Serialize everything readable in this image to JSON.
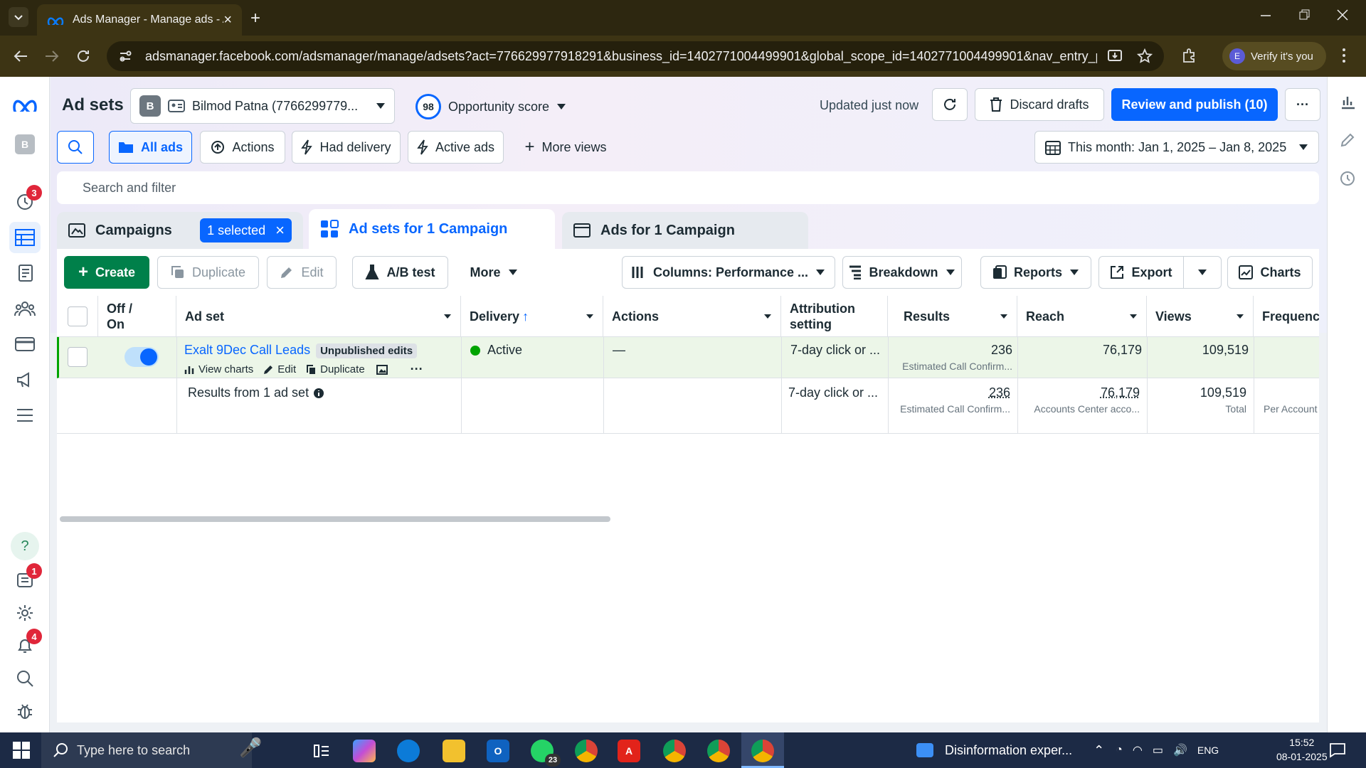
{
  "browser": {
    "tab_title": "Ads Manager - Manage ads - A",
    "url": "adsmanager.facebook.com/adsmanager/manage/adsets?act=776629977918291&business_id=1402771004499901&global_scope_id=1402771004499901&nav_entry_point=...",
    "verify_label": "Verify it's you",
    "profile_initial": "E"
  },
  "leftnav": {
    "account_initial": "B",
    "badges": {
      "clock": "3",
      "notes": "1",
      "bell": "4"
    },
    "help": "?"
  },
  "header": {
    "page_title": "Ad sets",
    "account_initial": "B",
    "account_name": "Bilmod Patna (7766299779...",
    "opportunity_value": "98",
    "opportunity_label": "Opportunity score",
    "updated": "Updated just now",
    "discard_label": "Discard drafts",
    "publish_label": "Review and publish (10)",
    "more": "···"
  },
  "views": {
    "all_ads": "All ads",
    "actions": "Actions",
    "had_delivery": "Had delivery",
    "active_ads": "Active ads",
    "more_views": "More views",
    "date_range": "This month: Jan 1, 2025 – Jan 8, 2025"
  },
  "filter": {
    "placeholder": "Search and filter"
  },
  "levels": {
    "campaigns": "Campaigns",
    "selected": "1 selected",
    "adsets": "Ad sets for 1 Campaign",
    "ads": "Ads for 1 Campaign"
  },
  "toolbar": {
    "create": "Create",
    "duplicate": "Duplicate",
    "edit": "Edit",
    "ab_test": "A/B test",
    "more": "More",
    "columns": "Columns: Performance ...",
    "breakdown": "Breakdown",
    "reports": "Reports",
    "export": "Export",
    "charts": "Charts"
  },
  "table": {
    "headers": {
      "onoff": "Off / On",
      "adset": "Ad set",
      "delivery": "Delivery",
      "delivery_sort": "↑",
      "actions": "Actions",
      "attribution": "Attribution setting",
      "results": "Results",
      "reach": "Reach",
      "views": "Views",
      "frequency": "Frequenc"
    },
    "row": {
      "name": "Exalt 9Dec Call Leads",
      "badge": "Unpublished edits",
      "view_charts": "View charts",
      "edit": "Edit",
      "duplicate": "Duplicate",
      "more": "···",
      "delivery": "Active",
      "actions": "—",
      "attribution": "7-day click or ...",
      "results": "236",
      "results_sub": "Estimated Call Confirm...",
      "reach": "76,179",
      "views": "109,519"
    },
    "summary": {
      "label": "Results from 1 ad set",
      "attribution": "7-day click or ...",
      "results": "236",
      "results_sub": "Estimated Call Confirm...",
      "reach": "76,179",
      "reach_sub": "Accounts Center acco...",
      "views": "109,519",
      "views_sub": "Total",
      "frequency_sub": "Per Account"
    }
  },
  "taskbar": {
    "search_placeholder": "Type here to search",
    "whatsapp_count": "23",
    "news": "Disinformation exper...",
    "lang": "ENG",
    "time": "15:52",
    "date": "08-01-2025"
  },
  "colors": {
    "accent": "#0866ff",
    "create": "#00804a",
    "active_dot": "#00a400",
    "badge": "#e0263a"
  }
}
